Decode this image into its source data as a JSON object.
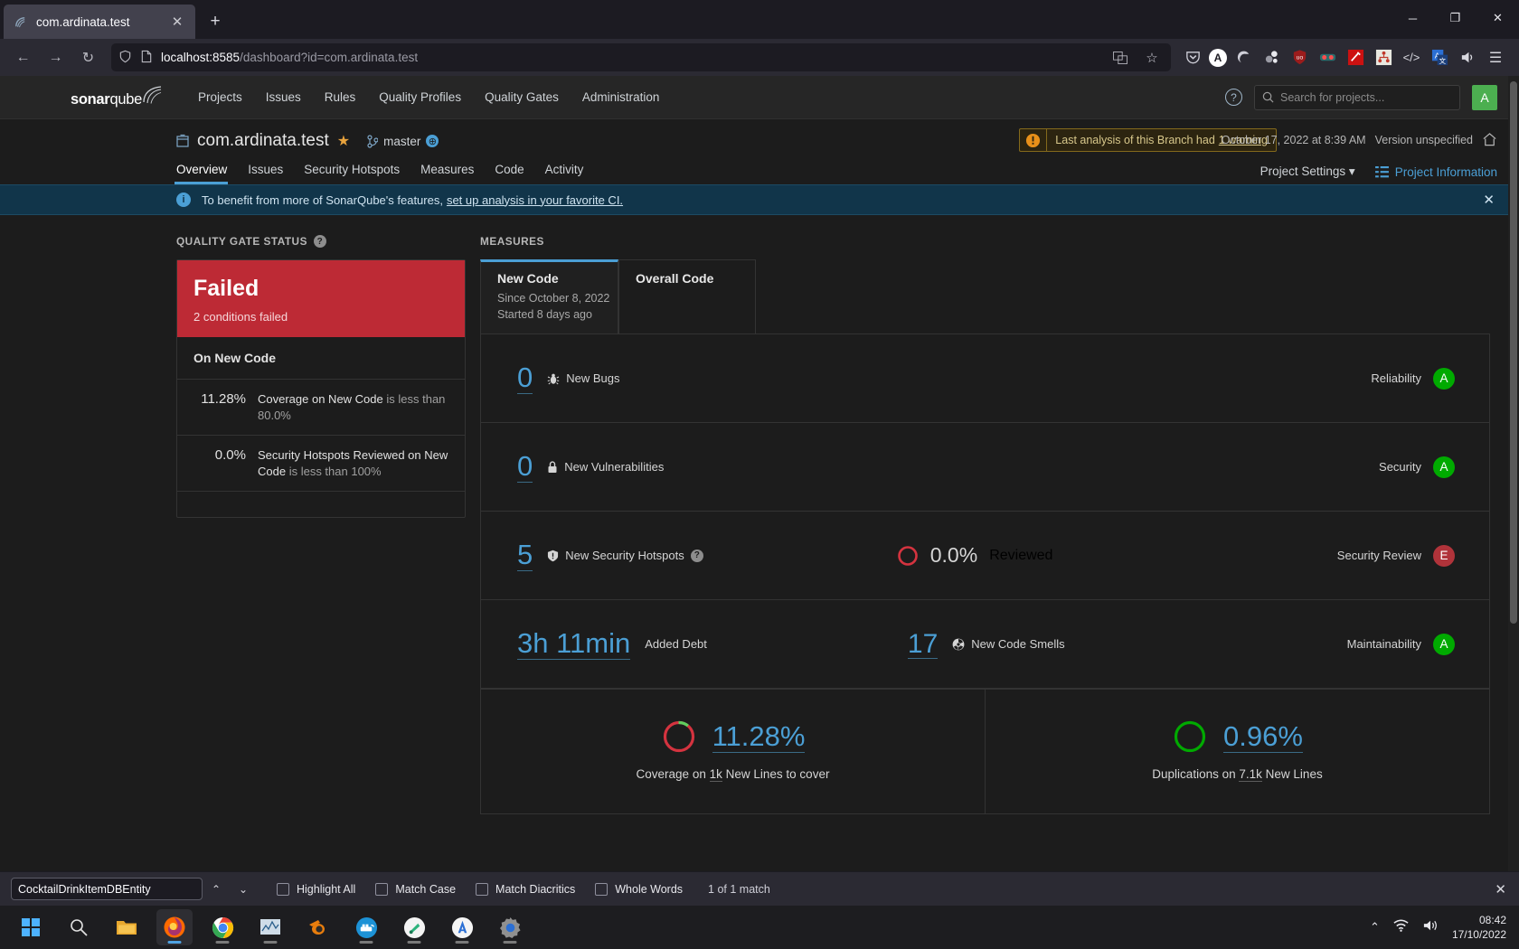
{
  "browser": {
    "tab": {
      "title": "com.ardinata.test",
      "favicon": "sonarqube-icon",
      "close": "✕"
    },
    "new_tab": "+",
    "window_controls": {
      "minimize": "─",
      "maximize": "❐",
      "close": "✕"
    },
    "nav": {
      "back": "←",
      "forward": "→",
      "reload": "↻"
    },
    "url": {
      "host": "localhost:8585",
      "path": "/dashboard?id=com.ardinata.test",
      "shield": "shield-icon",
      "page": "page-icon",
      "translate": "translate-icon",
      "bookmark": "☆"
    },
    "extensions": [
      {
        "name": "pocket-icon",
        "glyph": "♡",
        "color": "#cfcfd8",
        "bg": "transparent"
      },
      {
        "name": "account-icon",
        "glyph": "A",
        "color": "#1c1b22",
        "bg": "#ffffff"
      },
      {
        "name": "edge-icon",
        "glyph": "e",
        "color": "#d8d8df",
        "bg": "transparent"
      },
      {
        "name": "molecule-icon",
        "glyph": "⚇",
        "color": "#d8d8df",
        "bg": "transparent"
      },
      {
        "name": "ublock-origin-icon",
        "glyph": "uo",
        "color": "#ffffff",
        "bg": "#9b1c1c"
      },
      {
        "name": "goggles-icon",
        "glyph": "◉",
        "color": "#ff4d4d",
        "bg": "#2a6d6d"
      },
      {
        "name": "wand-icon",
        "glyph": "✦",
        "color": "#ffffff",
        "bg": "#cc1111"
      },
      {
        "name": "sitemap-icon",
        "glyph": "⚘",
        "color": "#c0392b",
        "bg": "#e8e8e0"
      },
      {
        "name": "code-icon",
        "glyph": "</>",
        "color": "#d8d8df",
        "bg": "transparent"
      },
      {
        "name": "translator-icon",
        "glyph": "A文",
        "color": "#ffffff",
        "bg": "#2b6fd4"
      },
      {
        "name": "volume-icon",
        "glyph": "🔊",
        "color": "#d8d8df",
        "bg": "transparent"
      },
      {
        "name": "menu-icon",
        "glyph": "☰",
        "color": "#d8d8df",
        "bg": "transparent"
      }
    ]
  },
  "sonarqube": {
    "logo": {
      "bold": "sonar",
      "light": "qube"
    },
    "nav_items": [
      "Projects",
      "Issues",
      "Rules",
      "Quality Profiles",
      "Quality Gates",
      "Administration"
    ],
    "help": "?",
    "search_placeholder": "Search for projects...",
    "avatar_letter": "A",
    "project": {
      "name": "com.ardinata.test",
      "branch": "master",
      "warning_text": "Last analysis of this Branch had",
      "warning_link": "1 warning",
      "analysis_date": "October 17, 2022 at 8:39 AM",
      "version": "Version unspecified",
      "tabs": [
        "Overview",
        "Issues",
        "Security Hotspots",
        "Measures",
        "Code",
        "Activity"
      ],
      "active_tab": "Overview",
      "settings_label": "Project Settings",
      "information_label": "Project Information"
    },
    "info_banner": {
      "text": "To benefit from more of SonarQube's features,",
      "link": "set up analysis in your favorite CI.",
      "close": "✕"
    },
    "quality_gate": {
      "section_title": "QUALITY GATE STATUS",
      "status": "Failed",
      "conditions_failed": "2 conditions failed",
      "group_title": "On New Code",
      "conditions": [
        {
          "value": "11.28%",
          "metric": "Coverage on New Code",
          "operator": "is less than 80.0%"
        },
        {
          "value": "0.0%",
          "metric": "Security Hotspots Reviewed on New Code",
          "operator": "is less than 100%"
        }
      ]
    },
    "measures": {
      "section_title": "MEASURES",
      "tabs": [
        {
          "label": "New Code",
          "sub1": "Since October 8, 2022",
          "sub2": "Started 8 days ago",
          "active": true
        },
        {
          "label": "Overall Code",
          "sub1": "",
          "sub2": "",
          "active": false
        }
      ],
      "rows": [
        {
          "value": "0",
          "icon": "bug-icon",
          "label": "New Bugs",
          "rating_label": "Reliability",
          "rating": "A",
          "rating_color": "#00aa00"
        },
        {
          "value": "0",
          "icon": "vulnerability-icon",
          "label": "New Vulnerabilities",
          "rating_label": "Security",
          "rating": "A",
          "rating_color": "#00aa00"
        },
        {
          "value": "5",
          "icon": "security-hotspot-icon",
          "label": "New Security Hotspots",
          "has_help": true,
          "secondary_value": "0.0%",
          "secondary_label": "Reviewed",
          "rating_label": "Security Review",
          "rating": "E",
          "rating_color": "#b0333a"
        },
        {
          "value": "3h 11min",
          "icon": "debt-icon",
          "label": "Added Debt",
          "secondary_value": "17",
          "secondary_label": "New Code Smells",
          "rating_label": "Maintainability",
          "rating": "A",
          "rating_color": "#00aa00"
        }
      ],
      "bottom": [
        {
          "percent": "11.28%",
          "fill": 11.28,
          "prefix": "Coverage on",
          "amount": "1k",
          "suffix": "New Lines to cover",
          "arc_color": "#5ece5e",
          "track_color": "#d4333f"
        },
        {
          "percent": "0.96%",
          "fill": 0.96,
          "prefix": "Duplications on",
          "amount": "7.1k",
          "suffix": "New Lines",
          "arc_color": "#00aa00",
          "track_color": "#00aa00"
        }
      ]
    }
  },
  "findbar": {
    "query": "CocktailDrinkItemDBEntity",
    "prev": "⌃",
    "next": "⌄",
    "options": [
      "Highlight All",
      "Match Case",
      "Match Diacritics",
      "Whole Words"
    ],
    "match_count": "1 of 1 match",
    "close": "✕"
  },
  "taskbar": {
    "items": [
      {
        "name": "start-icon",
        "glyph": "⊞",
        "active": false,
        "running": false
      },
      {
        "name": "search-icon",
        "glyph": "⚲",
        "active": false,
        "running": false
      },
      {
        "name": "file-explorer-icon",
        "glyph": "🗀",
        "active": false,
        "running": false
      },
      {
        "name": "firefox-icon",
        "glyph": "◉",
        "active": true,
        "running": true
      },
      {
        "name": "chrome-icon",
        "glyph": "◉",
        "active": false,
        "running": true
      },
      {
        "name": "task-manager-icon",
        "glyph": "📈",
        "active": false,
        "running": true
      },
      {
        "name": "blender-icon",
        "glyph": "◔",
        "active": false,
        "running": false
      },
      {
        "name": "docker-icon",
        "glyph": "🐳",
        "active": false,
        "running": true
      },
      {
        "name": "sourcetree-icon",
        "glyph": "◈",
        "active": false,
        "running": true
      },
      {
        "name": "android-studio-icon",
        "glyph": "A",
        "active": false,
        "running": true
      },
      {
        "name": "settings-icon",
        "glyph": "⚙",
        "active": false,
        "running": true
      }
    ],
    "tray": {
      "chevron": "⌃",
      "wifi": "wifi-icon",
      "volume": "volume-icon",
      "time": "08:42",
      "date": "17/10/2022"
    }
  }
}
